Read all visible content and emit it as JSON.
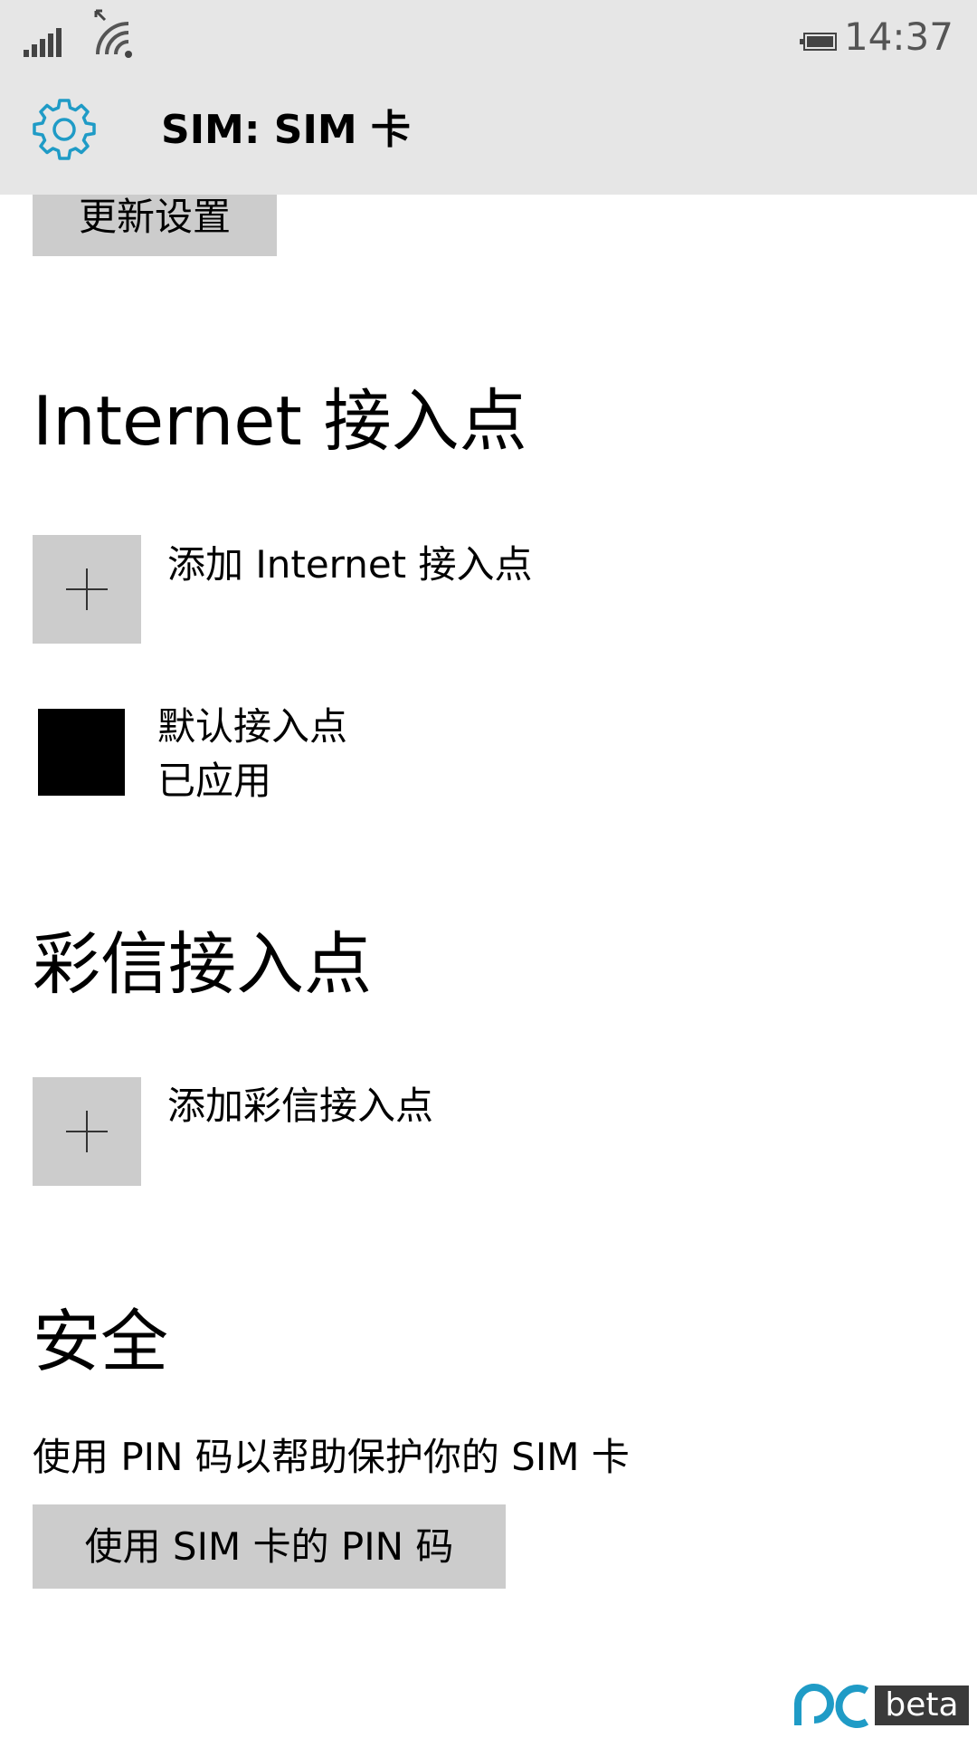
{
  "status_bar": {
    "time": "14:37",
    "signal_icon": "signal-bars-icon",
    "wifi_icon": "wifi-icon",
    "battery_icon": "battery-icon"
  },
  "header": {
    "icon": "gear-icon",
    "title": "SIM: SIM 卡",
    "accent_color": "#1f9bc6"
  },
  "main": {
    "update_button_label": "更新设置",
    "internet_section": {
      "title": "Internet 接入点",
      "add_label": "添加 Internet 接入点",
      "default_ap_name": "默认接入点",
      "default_ap_status": "已应用"
    },
    "mms_section": {
      "title": "彩信接入点",
      "add_label": "添加彩信接入点"
    },
    "security_section": {
      "title": "安全",
      "description": "使用 PIN 码以帮助保护你的 SIM 卡",
      "pin_button_label": "使用 SIM 卡的 PIN 码"
    }
  },
  "watermark": {
    "logo_icon": "pc-logo-icon",
    "text": "beta"
  }
}
